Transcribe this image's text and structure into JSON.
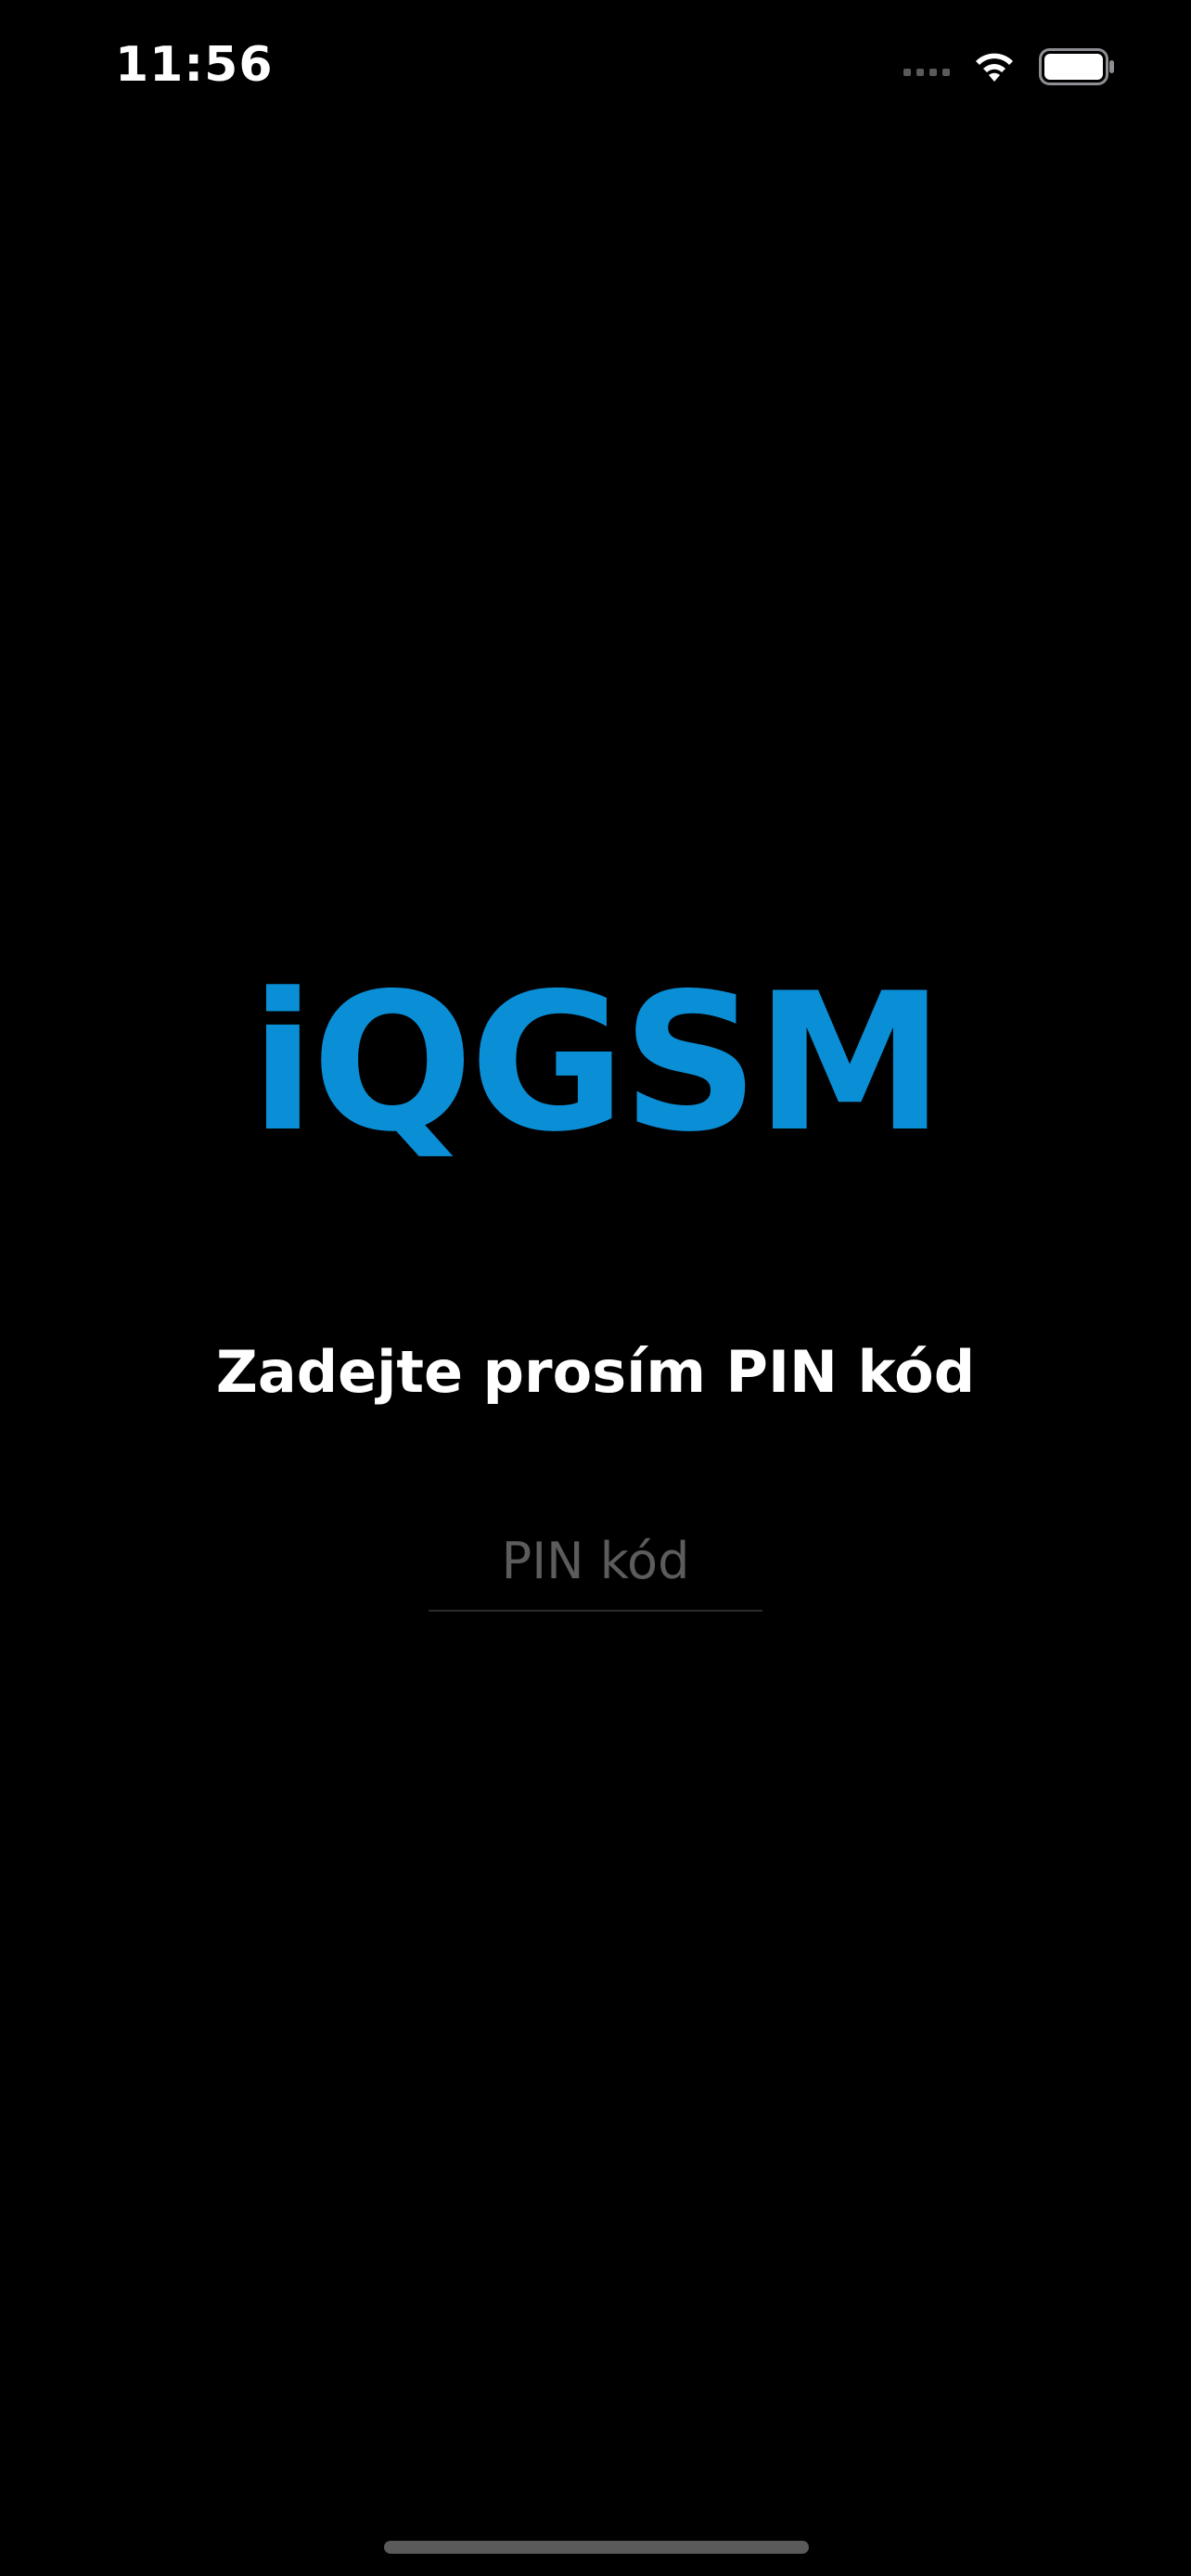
{
  "status_bar": {
    "time": "11:56",
    "icons": [
      "signal-dots-icon",
      "wifi-icon",
      "battery-icon"
    ]
  },
  "app": {
    "logo_text": "iQGSM",
    "prompt": "Zadejte prosím PIN kód"
  },
  "pin_field": {
    "value": "",
    "placeholder": "PIN kód"
  },
  "colors": {
    "background": "#000000",
    "brand": "#0a8fd6",
    "text": "#ffffff",
    "placeholder": "#5c5c5e"
  }
}
